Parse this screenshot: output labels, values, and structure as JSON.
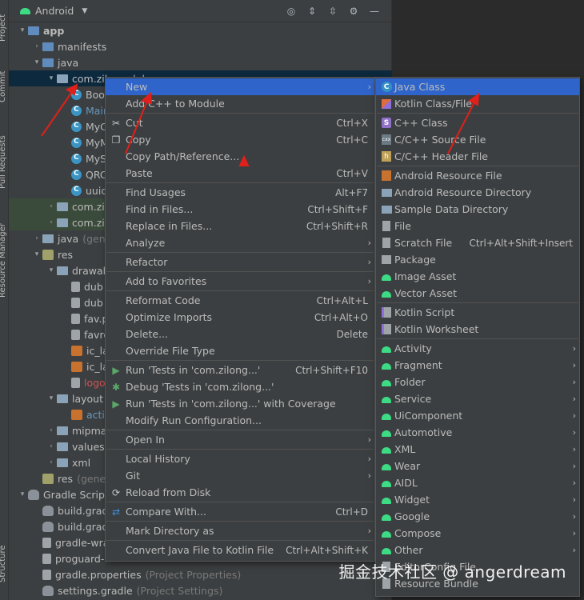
{
  "side_tabs": [
    "Project",
    "Commit",
    "Pull Requests",
    "Resource Manager",
    "Structure"
  ],
  "toolbar": {
    "view": "Android"
  },
  "tree": [
    {
      "depth": 0,
      "arrow": "▾",
      "icon": "folder blue",
      "text": "app",
      "style": "bold"
    },
    {
      "depth": 1,
      "arrow": "›",
      "icon": "folder blue",
      "text": "manifests"
    },
    {
      "depth": 1,
      "arrow": "▾",
      "icon": "folder blue",
      "text": "java"
    },
    {
      "depth": 2,
      "arrow": "▾",
      "icon": "folder",
      "text": "com.zilong.dubao",
      "selected": true
    },
    {
      "depth": 3,
      "arrow": "",
      "icon": "cls",
      "text": "Boo"
    },
    {
      "depth": 3,
      "arrow": "",
      "icon": "cls",
      "text": "Main",
      "style": "blue"
    },
    {
      "depth": 3,
      "arrow": "",
      "icon": "cls",
      "text": "MyC"
    },
    {
      "depth": 3,
      "arrow": "",
      "icon": "cls",
      "text": "MyM"
    },
    {
      "depth": 3,
      "arrow": "",
      "icon": "cls",
      "text": "MyS"
    },
    {
      "depth": 3,
      "arrow": "",
      "icon": "cls",
      "text": "QRC"
    },
    {
      "depth": 3,
      "arrow": "",
      "icon": "cls",
      "text": "uuid"
    },
    {
      "depth": 2,
      "arrow": "›",
      "icon": "folder",
      "text": "com.zilo",
      "highlight": true
    },
    {
      "depth": 2,
      "arrow": "›",
      "icon": "folder",
      "text": "com.zilo",
      "highlight": true
    },
    {
      "depth": 1,
      "arrow": "›",
      "icon": "folder",
      "text": "java",
      "hint": "(gene"
    },
    {
      "depth": 1,
      "arrow": "▾",
      "icon": "res",
      "text": "res"
    },
    {
      "depth": 2,
      "arrow": "▾",
      "icon": "folder",
      "text": "drawab"
    },
    {
      "depth": 3,
      "arrow": "",
      "icon": "file",
      "text": "dub"
    },
    {
      "depth": 3,
      "arrow": "",
      "icon": "file",
      "text": "dub"
    },
    {
      "depth": 3,
      "arrow": "",
      "icon": "file",
      "text": "fav.p"
    },
    {
      "depth": 3,
      "arrow": "",
      "icon": "file",
      "text": "favre"
    },
    {
      "depth": 3,
      "arrow": "",
      "icon": "xml",
      "text": "ic_la"
    },
    {
      "depth": 3,
      "arrow": "",
      "icon": "xml",
      "text": "ic_la"
    },
    {
      "depth": 3,
      "arrow": "",
      "icon": "file",
      "text": "logo",
      "style": "red"
    },
    {
      "depth": 2,
      "arrow": "▾",
      "icon": "folder",
      "text": "layout"
    },
    {
      "depth": 3,
      "arrow": "",
      "icon": "xml",
      "text": "activ",
      "style": "blue"
    },
    {
      "depth": 2,
      "arrow": "›",
      "icon": "folder",
      "text": "mipmap"
    },
    {
      "depth": 2,
      "arrow": "›",
      "icon": "folder",
      "text": "values"
    },
    {
      "depth": 2,
      "arrow": "›",
      "icon": "folder",
      "text": "xml"
    },
    {
      "depth": 1,
      "arrow": "",
      "icon": "res",
      "text": "res",
      "hint": "(gener"
    },
    {
      "depth": 0,
      "arrow": "▾",
      "icon": "gradle",
      "text": "Gradle Scripts"
    },
    {
      "depth": 1,
      "arrow": "",
      "icon": "gradle",
      "text": "build.grad"
    },
    {
      "depth": 1,
      "arrow": "",
      "icon": "gradle",
      "text": "build.grad"
    },
    {
      "depth": 1,
      "arrow": "",
      "icon": "file",
      "text": "gradle-wra"
    },
    {
      "depth": 1,
      "arrow": "",
      "icon": "file",
      "text": "proguard-"
    },
    {
      "depth": 1,
      "arrow": "",
      "icon": "file",
      "text": "gradle.properties",
      "hint": "(Project Properties)"
    },
    {
      "depth": 1,
      "arrow": "",
      "icon": "gradle",
      "text": "settings.gradle",
      "hint": "(Project Settings)"
    }
  ],
  "context_menu": [
    {
      "label": "New",
      "submenu": true,
      "active": true
    },
    {
      "label": "Add C++ to Module"
    },
    {
      "sep": true
    },
    {
      "label": "Cut",
      "shortcut": "Ctrl+X",
      "icon": "cut"
    },
    {
      "label": "Copy",
      "shortcut": "Ctrl+C",
      "icon": "copy"
    },
    {
      "label": "Copy Path/Reference..."
    },
    {
      "label": "Paste",
      "shortcut": "Ctrl+V",
      "icon": "paste"
    },
    {
      "sep": true
    },
    {
      "label": "Find Usages",
      "shortcut": "Alt+F7"
    },
    {
      "label": "Find in Files...",
      "shortcut": "Ctrl+Shift+F"
    },
    {
      "label": "Replace in Files...",
      "shortcut": "Ctrl+Shift+R"
    },
    {
      "label": "Analyze",
      "submenu": true
    },
    {
      "sep": true
    },
    {
      "label": "Refactor",
      "submenu": true
    },
    {
      "sep": true
    },
    {
      "label": "Add to Favorites",
      "submenu": true
    },
    {
      "sep": true
    },
    {
      "label": "Reformat Code",
      "shortcut": "Ctrl+Alt+L"
    },
    {
      "label": "Optimize Imports",
      "shortcut": "Ctrl+Alt+O"
    },
    {
      "label": "Delete...",
      "shortcut": "Delete"
    },
    {
      "label": "Override File Type",
      "disabled": true
    },
    {
      "sep": true
    },
    {
      "label": "Run 'Tests in 'com.zilong...'",
      "shortcut": "Ctrl+Shift+F10",
      "icon": "play"
    },
    {
      "label": "Debug 'Tests in 'com.zilong...'",
      "icon": "bug"
    },
    {
      "label": "Run 'Tests in 'com.zilong...' with Coverage",
      "icon": "cov"
    },
    {
      "label": "Modify Run Configuration..."
    },
    {
      "sep": true
    },
    {
      "label": "Open In",
      "submenu": true
    },
    {
      "sep": true
    },
    {
      "label": "Local History",
      "submenu": true
    },
    {
      "label": "Git",
      "submenu": true
    },
    {
      "label": "Reload from Disk",
      "icon": "reload"
    },
    {
      "sep": true
    },
    {
      "label": "Compare With...",
      "shortcut": "Ctrl+D",
      "icon": "compare"
    },
    {
      "sep": true
    },
    {
      "label": "Mark Directory as",
      "submenu": true
    },
    {
      "sep": true
    },
    {
      "label": "Convert Java File to Kotlin File",
      "shortcut": "Ctrl+Alt+Shift+K"
    }
  ],
  "new_submenu": [
    {
      "label": "Java Class",
      "icon": "cls",
      "active": true
    },
    {
      "label": "Kotlin Class/File",
      "icon": "kt"
    },
    {
      "sep": true
    },
    {
      "label": "C++ Class",
      "icon": "cpp"
    },
    {
      "label": "C/C++ Source File",
      "icon": "cxx"
    },
    {
      "label": "C/C++ Header File",
      "icon": "h"
    },
    {
      "sep": true
    },
    {
      "label": "Android Resource File",
      "icon": "resf"
    },
    {
      "label": "Android Resource Directory",
      "icon": "dir"
    },
    {
      "label": "Sample Data Directory",
      "icon": "dir"
    },
    {
      "label": "File",
      "icon": "file"
    },
    {
      "label": "Scratch File",
      "shortcut": "Ctrl+Alt+Shift+Insert",
      "icon": "file"
    },
    {
      "label": "Package",
      "icon": "pkg"
    },
    {
      "label": "Image Asset",
      "icon": "andr"
    },
    {
      "label": "Vector Asset",
      "icon": "andr"
    },
    {
      "sep": true
    },
    {
      "label": "Kotlin Script",
      "icon": "script"
    },
    {
      "label": "Kotlin Worksheet",
      "icon": "script"
    },
    {
      "sep": true
    },
    {
      "label": "Activity",
      "icon": "andr",
      "submenu": true
    },
    {
      "label": "Fragment",
      "icon": "andr",
      "submenu": true
    },
    {
      "label": "Folder",
      "icon": "andr",
      "submenu": true
    },
    {
      "label": "Service",
      "icon": "andr",
      "submenu": true
    },
    {
      "label": "UiComponent",
      "icon": "andr",
      "submenu": true
    },
    {
      "label": "Automotive",
      "icon": "andr",
      "submenu": true
    },
    {
      "label": "XML",
      "icon": "andr",
      "submenu": true
    },
    {
      "label": "Wear",
      "icon": "andr",
      "submenu": true
    },
    {
      "label": "AIDL",
      "icon": "andr",
      "submenu": true
    },
    {
      "label": "Widget",
      "icon": "andr",
      "submenu": true
    },
    {
      "label": "Google",
      "icon": "andr",
      "submenu": true
    },
    {
      "label": "Compose",
      "icon": "andr",
      "submenu": true
    },
    {
      "label": "Other",
      "icon": "andr",
      "submenu": true
    },
    {
      "label": "EditorConfig File",
      "icon": "file"
    },
    {
      "label": "Resource Bundle",
      "icon": "file"
    }
  ],
  "watermark": "掘金技术社区 @ angerdream",
  "colors": {
    "menu_bg": "#3c3f41",
    "active": "#2f65ca",
    "annotation": "#e0201a"
  }
}
